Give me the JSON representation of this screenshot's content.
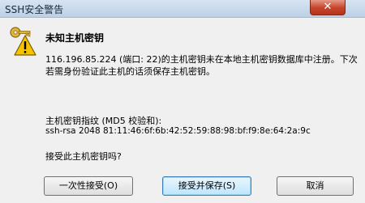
{
  "window": {
    "title": "SSH安全警告",
    "close_label": "✕"
  },
  "dialog": {
    "heading": "未知主机密钥",
    "message": "116.196.85.224 (端口: 22)的主机密钥未在本地主机密钥数据库中注册。下次若需身份验证此主机的话须保存主机密钥。",
    "fingerprint_label": "主机密钥指纹 (MD5 校验和):",
    "fingerprint_value": "ssh-rsa 2048 81:11:46:6f:6b:42:52:59:88:98:bf:f9:8e:64:2a:9c",
    "question": "接受此主机密钥吗?"
  },
  "buttons": {
    "accept_once": "一次性接受(O)",
    "accept_save": "接受并保存(S)",
    "cancel": "取消"
  }
}
